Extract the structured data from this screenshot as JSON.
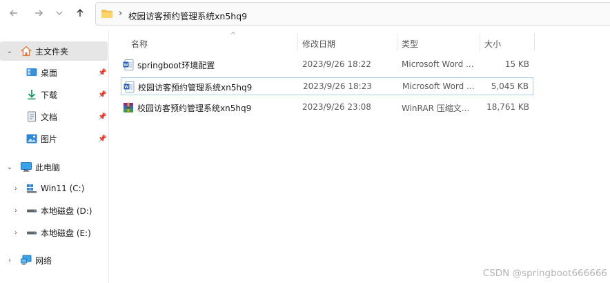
{
  "nav": {
    "back_icon": "arrow-left-icon",
    "forward_icon": "arrow-right-icon",
    "recent_icon": "chevron-down-icon",
    "up_icon": "arrow-up-icon"
  },
  "address": {
    "separator": "›",
    "path": "校园访客预约管理系统xn5hq9"
  },
  "sidebar": {
    "items": [
      {
        "label": "主文件夹",
        "icon": "home-icon",
        "expanded": true
      },
      {
        "label": "桌面",
        "icon": "desktop-icon",
        "pinned": true
      },
      {
        "label": "下载",
        "icon": "download-icon",
        "pinned": true
      },
      {
        "label": "文档",
        "icon": "document-icon",
        "pinned": true
      },
      {
        "label": "图片",
        "icon": "pictures-icon",
        "pinned": true
      },
      {
        "label": "此电脑",
        "icon": "computer-icon",
        "expanded": true
      },
      {
        "label": "Win11 (C:)",
        "icon": "drive-windows-icon"
      },
      {
        "label": "本地磁盘 (D:)",
        "icon": "drive-icon"
      },
      {
        "label": "本地磁盘 (E:)",
        "icon": "drive-icon"
      },
      {
        "label": "网络",
        "icon": "network-icon"
      }
    ]
  },
  "columns": {
    "name": "名称",
    "date": "修改日期",
    "type": "类型",
    "size": "大小"
  },
  "files": [
    {
      "name": "springboot环境配置",
      "date": "2023/9/26 18:22",
      "type": "Microsoft Word ...",
      "size": "15 KB",
      "icon": "word-doc-icon"
    },
    {
      "name": "校园访客预约管理系统xn5hq9",
      "date": "2023/9/26 18:23",
      "type": "Microsoft Word ...",
      "size": "5,045 KB",
      "icon": "word-doc-icon"
    },
    {
      "name": "校园访客预约管理系统xn5hq9",
      "date": "2023/9/26 23:08",
      "type": "WinRAR 压缩文...",
      "size": "18,761 KB",
      "icon": "winrar-archive-icon"
    }
  ],
  "watermark": "CSDN @springboot666666",
  "colors": {
    "accent": "#0067c0",
    "folder": "#f6c14b",
    "selected_border": "#a7cbed"
  }
}
